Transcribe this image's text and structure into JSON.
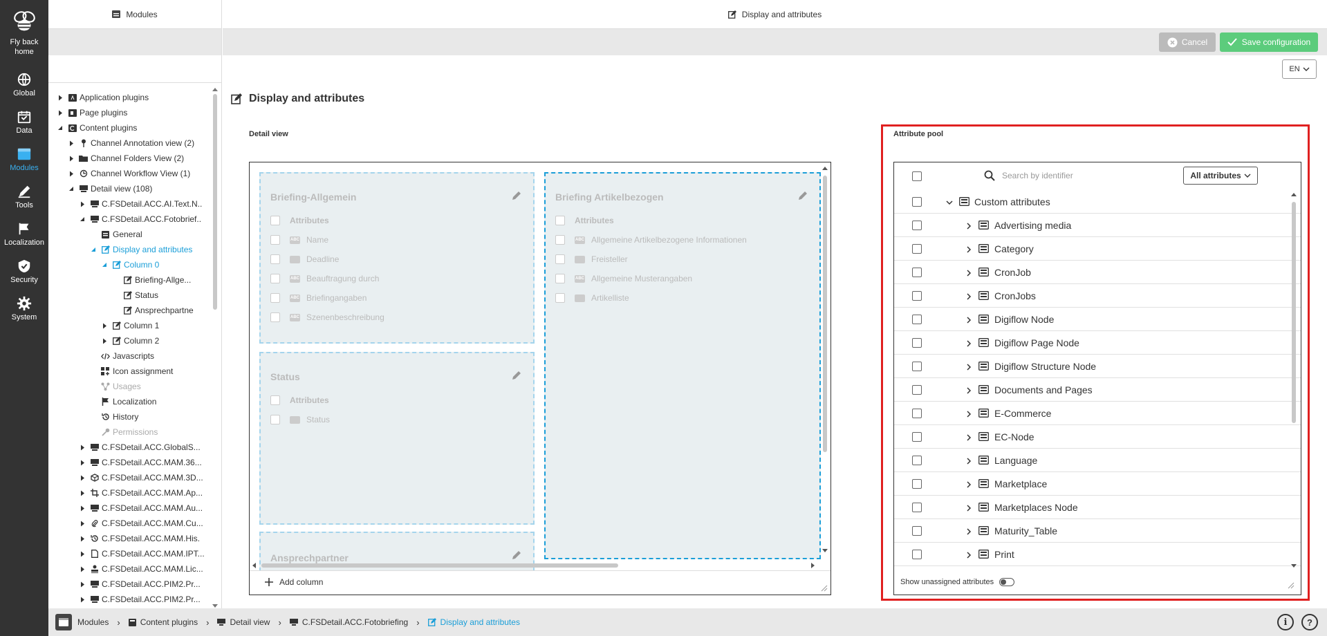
{
  "nav": {
    "home_label": "Fly back home",
    "items": [
      {
        "label": "Global",
        "icon": "globe-icon"
      },
      {
        "label": "Data",
        "icon": "calendar-icon"
      },
      {
        "label": "Modules",
        "icon": "modules-icon",
        "active": true
      },
      {
        "label": "Tools",
        "icon": "pencil-icon"
      },
      {
        "label": "Localization",
        "icon": "flag-icon"
      },
      {
        "label": "Security",
        "icon": "shield-check-icon"
      },
      {
        "label": "System",
        "icon": "gear-icon"
      }
    ]
  },
  "left_panel": {
    "title": "Modules"
  },
  "tree": [
    {
      "label": "Application plugins",
      "toggle": "closed",
      "icon": "app-plugin-icon"
    },
    {
      "label": "Page plugins",
      "toggle": "closed",
      "icon": "page-plugin-icon"
    },
    {
      "label": "Content plugins",
      "toggle": "open",
      "icon": "content-plugin-icon"
    },
    {
      "label": "Channel Annotation view (2)",
      "toggle": "closed",
      "icon": "pin-icon"
    },
    {
      "label": "Channel Folders View (2)",
      "toggle": "closed",
      "icon": "folder-icon"
    },
    {
      "label": "Channel Workflow View (1)",
      "toggle": "closed",
      "icon": "workflow-icon"
    },
    {
      "label": "Detail view (108)",
      "toggle": "open",
      "icon": "monitor-icon"
    },
    {
      "label": "C.FSDetail.ACC.AI.Text.N..",
      "toggle": "closed",
      "icon": "monitor-icon"
    },
    {
      "label": "C.FSDetail.ACC.Fotobrief..",
      "toggle": "open",
      "icon": "monitor-icon"
    },
    {
      "label": "General",
      "toggle": "none",
      "icon": "general-icon"
    },
    {
      "label": "Display and attributes",
      "toggle": "open",
      "icon": "edit-icon",
      "selected": true
    },
    {
      "label": "Column 0",
      "toggle": "open",
      "icon": "edit-icon",
      "selected": true
    },
    {
      "label": "Briefing-Allge...",
      "toggle": "none",
      "icon": "edit-icon"
    },
    {
      "label": "Status",
      "toggle": "none",
      "icon": "edit-icon"
    },
    {
      "label": "Ansprechpartne",
      "toggle": "none",
      "icon": "edit-icon"
    },
    {
      "label": "Column 1",
      "toggle": "closed",
      "icon": "edit-icon"
    },
    {
      "label": "Column 2",
      "toggle": "closed",
      "icon": "edit-icon"
    },
    {
      "label": "Javascripts",
      "toggle": "none",
      "icon": "code-icon"
    },
    {
      "label": "Icon assignment",
      "toggle": "none",
      "icon": "icon-assignment-icon"
    },
    {
      "label": "Usages",
      "toggle": "none",
      "icon": "usages-icon",
      "disabled": true
    },
    {
      "label": "Localization",
      "toggle": "none",
      "icon": "flag-icon"
    },
    {
      "label": "History",
      "toggle": "none",
      "icon": "history-icon"
    },
    {
      "label": "Permissions",
      "toggle": "none",
      "icon": "key-icon",
      "disabled": true
    },
    {
      "label": "C.FSDetail.ACC.GlobalS...",
      "toggle": "closed",
      "icon": "monitor-icon"
    },
    {
      "label": "C.FSDetail.ACC.MAM.36...",
      "toggle": "closed",
      "icon": "monitor-icon"
    },
    {
      "label": "C.FSDetail.ACC.MAM.3D...",
      "toggle": "closed",
      "icon": "cube-icon"
    },
    {
      "label": "C.FSDetail.ACC.MAM.Ap...",
      "toggle": "closed",
      "icon": "crop-icon"
    },
    {
      "label": "C.FSDetail.ACC.MAM.Au...",
      "toggle": "closed",
      "icon": "monitor-icon"
    },
    {
      "label": "C.FSDetail.ACC.MAM.Cu...",
      "toggle": "closed",
      "icon": "paperclip-icon"
    },
    {
      "label": "C.FSDetail.ACC.MAM.His.",
      "toggle": "closed",
      "icon": "history-icon"
    },
    {
      "label": "C.FSDetail.ACC.MAM.IPT...",
      "toggle": "closed",
      "icon": "file-icon"
    },
    {
      "label": "C.FSDetail.ACC.MAM.Lic...",
      "toggle": "closed",
      "icon": "stamp-icon"
    },
    {
      "label": "C.FSDetail.ACC.PIM2.Pr...",
      "toggle": "closed",
      "icon": "monitor-icon"
    },
    {
      "label": "C.FSDetail.ACC.PIM2.Pr...",
      "toggle": "closed",
      "icon": "monitor-icon"
    }
  ],
  "header": {
    "title": "Display and attributes"
  },
  "toolbar": {
    "cancel_label": "Cancel",
    "save_label": "Save configuration",
    "language": "EN"
  },
  "main": {
    "title": "Display and attributes",
    "detail_view_label": "Detail view",
    "add_column_label": "Add column",
    "groups": [
      {
        "title": "Briefing-Allgemein",
        "header": "Attributes",
        "items": [
          "Name",
          "Deadline",
          "Beauftragung durch",
          "Briefingangaben",
          "Szenenbeschreibung"
        ]
      },
      {
        "title": "Briefing Artikelbezogen",
        "header": "Attributes",
        "items": [
          "Allgemeine Artikelbezogene Informationen",
          "Freisteller",
          "Allgemeine Musterangaben",
          "Artikelliste"
        ]
      },
      {
        "title": "Status",
        "header": "Attributes",
        "items": [
          "Status"
        ]
      },
      {
        "title": "Ansprechpartner",
        "header": "",
        "items": []
      }
    ]
  },
  "attribute_pool": {
    "label": "Attribute pool",
    "search_placeholder": "Search by identifier",
    "filter_label": "All attributes",
    "root": "Custom attributes",
    "items": [
      "Advertising media",
      "Category",
      "CronJob",
      "CronJobs",
      "Digiflow Node",
      "Digiflow Page Node",
      "Digiflow Structure Node",
      "Documents and Pages",
      "E-Commerce",
      "EC-Node",
      "Language",
      "Marketplace",
      "Marketplaces Node",
      "Maturity_Table",
      "Print"
    ],
    "show_unassigned_label": "Show unassigned attributes"
  },
  "breadcrumb": [
    "Modules",
    "Content plugins",
    "Detail view",
    "C.FSDetail.ACC.Fotobriefing",
    "Display and attributes"
  ],
  "colors": {
    "accent": "#1a9ed8",
    "save": "#5ccc7c",
    "cancel": "#bbbbbb",
    "highlight": "#e02020",
    "nav": "#333333"
  }
}
